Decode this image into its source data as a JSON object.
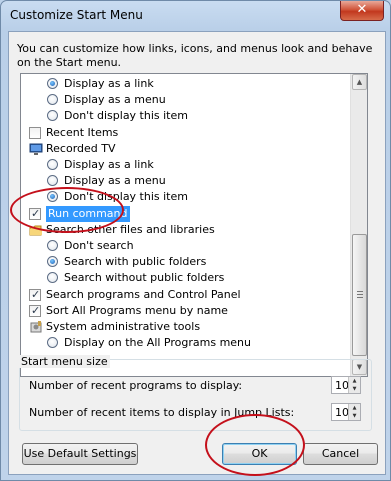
{
  "window": {
    "title": "Customize Start Menu",
    "close_glyph": "✕"
  },
  "description": "You can customize how links, icons, and menus look and behave on the Start menu.",
  "list": [
    {
      "kind": "radio",
      "label": "Display as a link",
      "checked": true
    },
    {
      "kind": "radio",
      "label": "Display as a menu",
      "checked": false
    },
    {
      "kind": "radio",
      "label": "Don't display this item",
      "checked": false
    },
    {
      "kind": "check",
      "label": "Recent Items",
      "checked": false
    },
    {
      "kind": "icon",
      "label": "Recorded TV",
      "icon": "monitor-icon"
    },
    {
      "kind": "radio",
      "label": "Display as a link",
      "checked": false
    },
    {
      "kind": "radio",
      "label": "Display as a menu",
      "checked": false
    },
    {
      "kind": "radio",
      "label": "Don't display this item",
      "checked": true
    },
    {
      "kind": "check",
      "label": "Run command",
      "checked": true,
      "selected": true
    },
    {
      "kind": "icon",
      "label": "Search other files and libraries",
      "icon": "folder-icon"
    },
    {
      "kind": "radio",
      "label": "Don't search",
      "checked": false
    },
    {
      "kind": "radio",
      "label": "Search with public folders",
      "checked": true
    },
    {
      "kind": "radio",
      "label": "Search without public folders",
      "checked": false
    },
    {
      "kind": "check",
      "label": "Search programs and Control Panel",
      "checked": true
    },
    {
      "kind": "check",
      "label": "Sort All Programs menu by name",
      "checked": true
    },
    {
      "kind": "icon",
      "label": "System administrative tools",
      "icon": "admin-tools-icon"
    },
    {
      "kind": "radio",
      "label": "Display on the All Programs menu",
      "checked": false
    }
  ],
  "start_menu_size": {
    "title": "Start menu size",
    "recent_programs_label": "Number of recent programs to display:",
    "recent_programs_value": "10",
    "jump_list_label": "Number of recent items to display in Jump Lists:",
    "jump_list_value": "10"
  },
  "buttons": {
    "defaults": "Use Default Settings",
    "ok": "OK",
    "cancel": "Cancel"
  },
  "colors": {
    "annotation_red": "#c4101b",
    "selection_blue": "#3399ff"
  }
}
